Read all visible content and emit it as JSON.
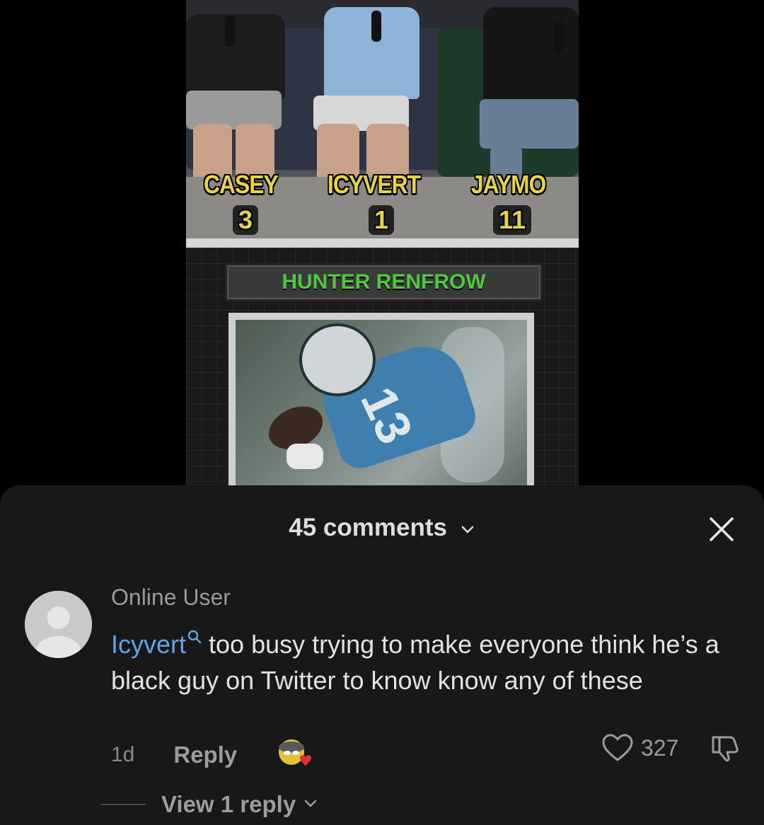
{
  "video": {
    "contestants": [
      {
        "name": "CASEY",
        "score": "3"
      },
      {
        "name": "ICYVERT",
        "score": "1"
      },
      {
        "name": "JAYMO",
        "score": "11"
      }
    ],
    "player_name": "HUNTER RENFROW",
    "jersey_number": "13"
  },
  "comments": {
    "header": "45 comments",
    "items": [
      {
        "author": "Online User",
        "mention": "Icyvert",
        "text": " too busy trying to make everyone think he’s a black guy on Twitter to know know any of these",
        "time": "1d",
        "reply_label": "Reply",
        "likes": "327",
        "view_replies": "View 1 reply"
      }
    ]
  },
  "icons": {
    "close": "close-icon",
    "chevron": "chevron-down-icon",
    "heart": "heart-icon",
    "dislike": "thumbs-down-icon",
    "emoji": "emoji-icon",
    "avatar": "default-avatar-icon"
  }
}
